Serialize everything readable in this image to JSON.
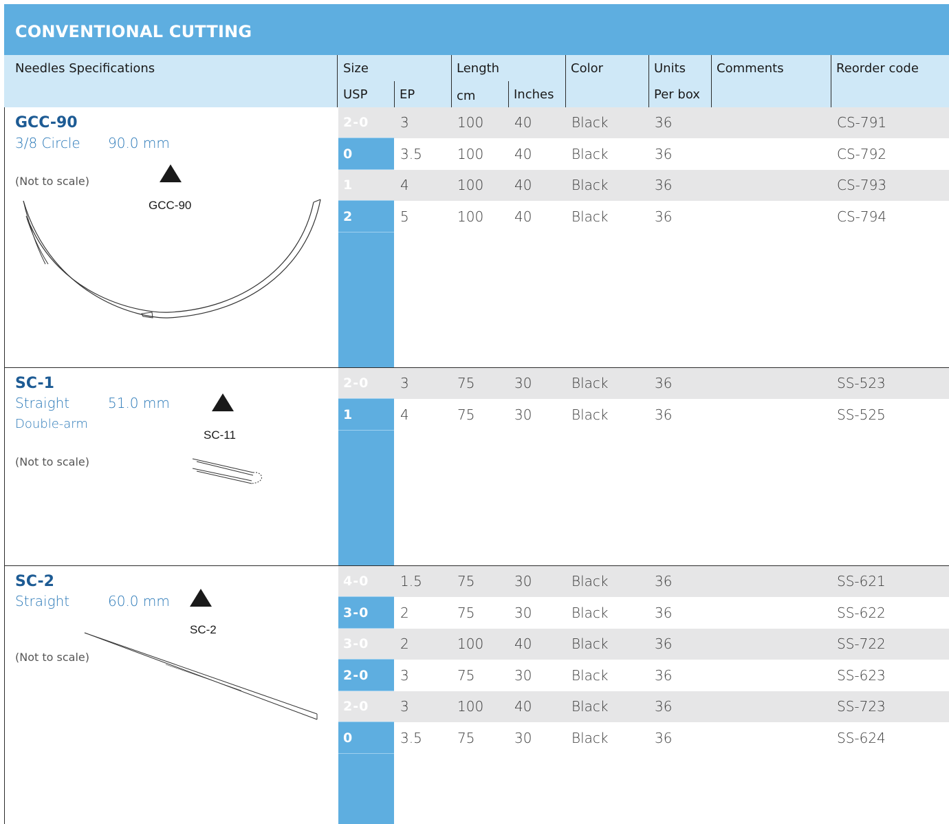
{
  "title": "CONVENTIONAL CUTTING",
  "header": {
    "specs": "Needles Specifications",
    "size": "Size",
    "usp": "USP",
    "ep": "EP",
    "length": "Length",
    "cm": "cm",
    "inches": "Inches",
    "color": "Color",
    "units": "Units",
    "per_box": "Per box",
    "comments": "Comments",
    "reorder": "Reorder code"
  },
  "sections": [
    {
      "name": "GCC-90",
      "shape": "3/8 Circle",
      "length": "90.0 mm",
      "note": "(Not to scale)",
      "drawing_label": "GCC-90",
      "rows": [
        {
          "usp": "2-0",
          "ep": "3",
          "cm": "100",
          "inches": "40",
          "color": "Black",
          "units": "36",
          "code": "CS-791"
        },
        {
          "usp": "0",
          "ep": "3.5",
          "cm": "100",
          "inches": "40",
          "color": "Black",
          "units": "36",
          "code": "CS-792"
        },
        {
          "usp": "1",
          "ep": "4",
          "cm": "100",
          "inches": "40",
          "color": "Black",
          "units": "36",
          "code": "CS-793"
        },
        {
          "usp": "2",
          "ep": "5",
          "cm": "100",
          "inches": "40",
          "color": "Black",
          "units": "36",
          "code": "CS-794"
        }
      ]
    },
    {
      "name": "SC-1",
      "shape": "Straight",
      "length": "51.0 mm",
      "arm": "Double-arm",
      "note": "(Not to scale)",
      "drawing_label": "SC-11",
      "rows": [
        {
          "usp": "2-0",
          "ep": "3",
          "cm": "75",
          "inches": "30",
          "color": "Black",
          "units": "36",
          "code": "SS-523"
        },
        {
          "usp": "1",
          "ep": "4",
          "cm": "75",
          "inches": "30",
          "color": "Black",
          "units": "36",
          "code": "SS-525"
        }
      ]
    },
    {
      "name": "SC-2",
      "shape": "Straight",
      "length": "60.0 mm",
      "note": "(Not to scale)",
      "drawing_label": "SC-2",
      "rows": [
        {
          "usp": "4-0",
          "ep": "1.5",
          "cm": "75",
          "inches": "30",
          "color": "Black",
          "units": "36",
          "code": "SS-621"
        },
        {
          "usp": "3-0",
          "ep": "2",
          "cm": "75",
          "inches": "30",
          "color": "Black",
          "units": "36",
          "code": "SS-622"
        },
        {
          "usp": "3-0",
          "ep": "2",
          "cm": "100",
          "inches": "40",
          "color": "Black",
          "units": "36",
          "code": "SS-722"
        },
        {
          "usp": "2-0",
          "ep": "3",
          "cm": "75",
          "inches": "30",
          "color": "Black",
          "units": "36",
          "code": "SS-623"
        },
        {
          "usp": "2-0",
          "ep": "3",
          "cm": "100",
          "inches": "40",
          "color": "Black",
          "units": "36",
          "code": "SS-723"
        },
        {
          "usp": "0",
          "ep": "3.5",
          "cm": "75",
          "inches": "30",
          "color": "Black",
          "units": "36",
          "code": "SS-624"
        }
      ]
    }
  ],
  "colors": {
    "accent": "#5eaee0",
    "header_bg": "#cfe8f7",
    "shade": "#e6e6e7",
    "name": "#1d5b94",
    "sub": "#2b79b8"
  }
}
